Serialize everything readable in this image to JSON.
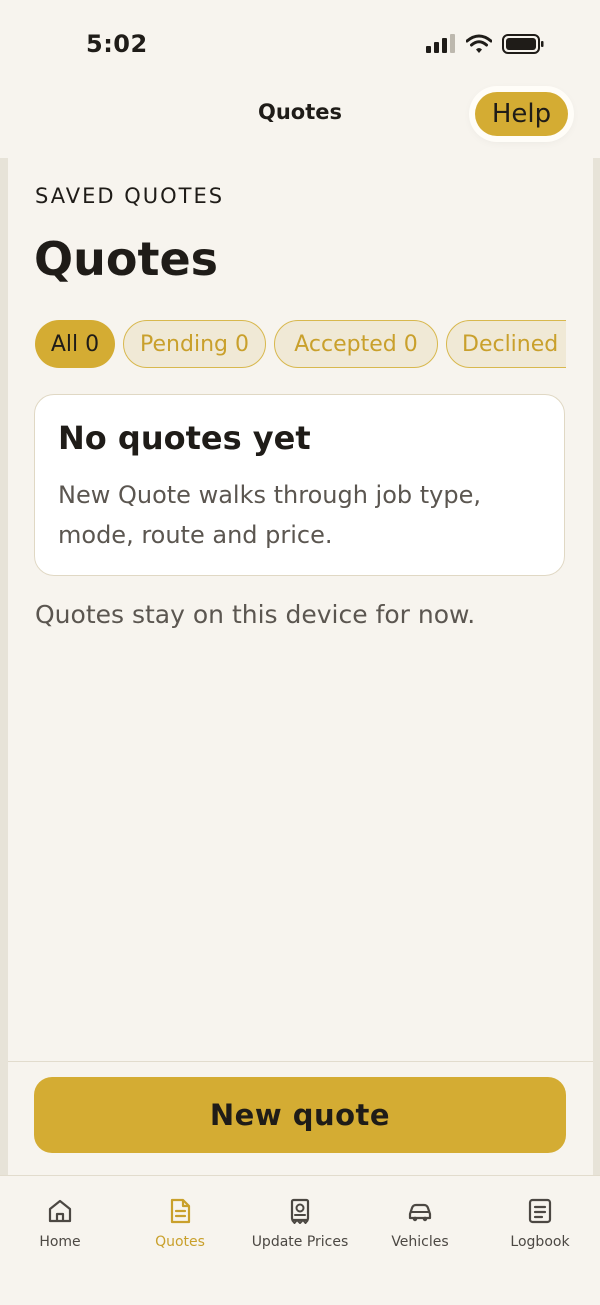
{
  "status": {
    "time": "5:02"
  },
  "header": {
    "title": "Quotes",
    "help_label": "Help"
  },
  "page": {
    "eyebrow": "SAVED QUOTES",
    "title": "Quotes"
  },
  "filters": [
    {
      "label": "All 0",
      "active": true
    },
    {
      "label": "Pending 0",
      "active": false
    },
    {
      "label": "Accepted 0",
      "active": false
    },
    {
      "label": "Declined",
      "active": false
    }
  ],
  "empty_state": {
    "title": "No quotes yet",
    "description": "New Quote walks through job type, mode, route and price."
  },
  "note": "Quotes stay on this device for now.",
  "primary_action": {
    "label": "New quote"
  },
  "tabs": [
    {
      "label": "Home",
      "icon": "home-icon",
      "active": false
    },
    {
      "label": "Quotes",
      "icon": "document-icon",
      "active": true
    },
    {
      "label": "Update Prices",
      "icon": "receipt-icon",
      "active": false
    },
    {
      "label": "Vehicles",
      "icon": "car-icon",
      "active": false
    },
    {
      "label": "Logbook",
      "icon": "list-icon",
      "active": false
    }
  ],
  "colors": {
    "accent": "#d4ac33",
    "background": "#f7f4ee",
    "text": "#1f1c18"
  }
}
